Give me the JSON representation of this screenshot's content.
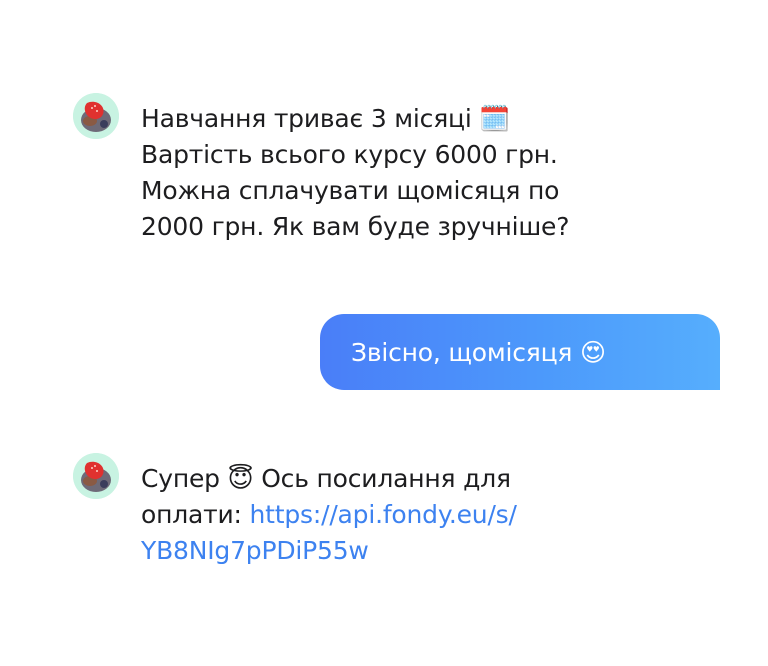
{
  "messages": [
    {
      "sender": "bot",
      "avatar_icon": "strawberry-cake-icon",
      "lines": [
        "Навчання триває 3 місяці 🗓️",
        "Вартість всього курсу 6000 грн.",
        "Можна сплачувати щомісяця по",
        "2000 грн. Як вам буде зручніше?"
      ]
    },
    {
      "sender": "user",
      "text": "Звісно, щомісяця 😍"
    },
    {
      "sender": "bot",
      "avatar_icon": "strawberry-cake-icon",
      "line1": "Супер 😇 Ось посилання для",
      "line2_prefix": "оплати: ",
      "link_part1": "https://api.fondy.eu/s/",
      "link_part2": "YB8NIg7pPDiP55w"
    }
  ],
  "colors": {
    "bubble_gradient_start": "#4a7ef8",
    "bubble_gradient_end": "#56aefd",
    "link": "#3d82f0",
    "avatar_bg": "#c8f3e2"
  }
}
